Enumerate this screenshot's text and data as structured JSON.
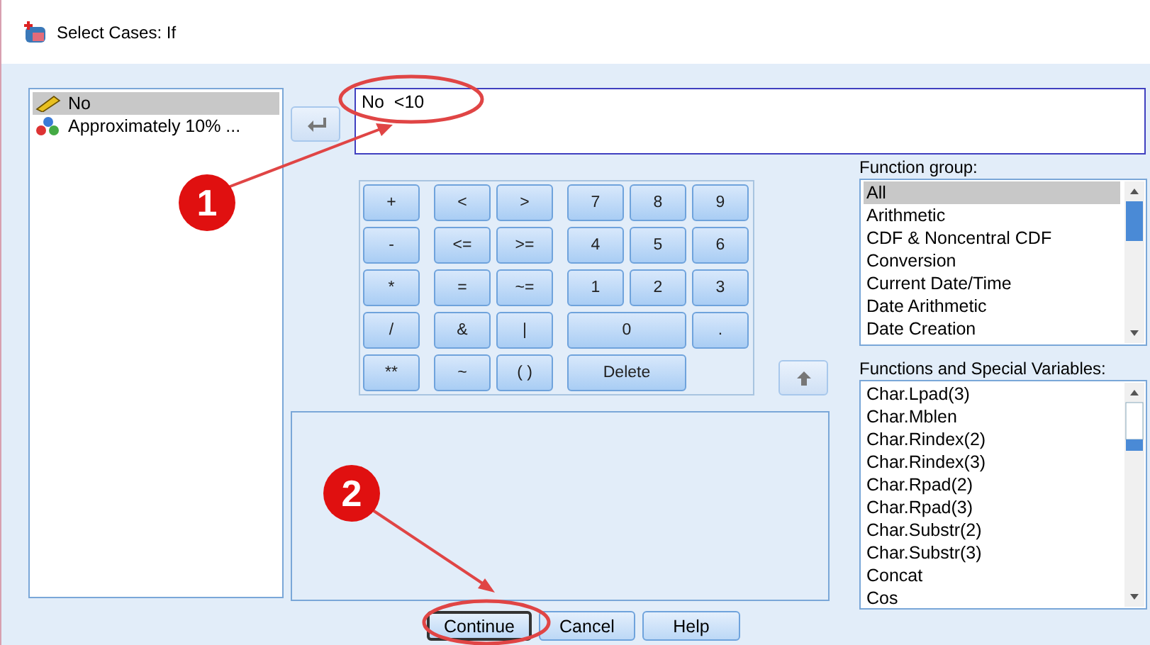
{
  "window": {
    "title": "Select Cases: If"
  },
  "variables": [
    {
      "name": "No",
      "kind": "scale",
      "selected": true
    },
    {
      "name": "Approximately 10% ...",
      "kind": "nominal",
      "selected": false
    }
  ],
  "expression": {
    "value": "No  <10"
  },
  "keypad": [
    {
      "ops": [
        "+"
      ],
      "compare": [
        "<",
        ">"
      ],
      "digits": [
        {
          "label": "7",
          "kind": "normal"
        },
        {
          "label": "8",
          "kind": "normal"
        },
        {
          "label": "9",
          "kind": "normal"
        }
      ]
    },
    {
      "ops": [
        "-"
      ],
      "compare": [
        "<=",
        ">="
      ],
      "digits": [
        {
          "label": "4",
          "kind": "normal"
        },
        {
          "label": "5",
          "kind": "normal"
        },
        {
          "label": "6",
          "kind": "normal"
        }
      ]
    },
    {
      "ops": [
        "*"
      ],
      "compare": [
        "=",
        "~="
      ],
      "digits": [
        {
          "label": "1",
          "kind": "normal"
        },
        {
          "label": "2",
          "kind": "normal"
        },
        {
          "label": "3",
          "kind": "normal"
        }
      ]
    },
    {
      "ops": [
        "/"
      ],
      "compare": [
        "&",
        "|"
      ],
      "digits": [
        {
          "label": "0",
          "kind": "wide"
        },
        {
          "label": ".",
          "kind": "normal"
        }
      ]
    },
    {
      "ops": [
        "**"
      ],
      "compare": [
        "~",
        "( )"
      ],
      "digits": [
        {
          "label": "Delete",
          "kind": "wide"
        }
      ]
    }
  ],
  "function_group": {
    "label": "Function group:",
    "items": [
      {
        "label": "All",
        "selected": true
      },
      {
        "label": "Arithmetic",
        "selected": false
      },
      {
        "label": "CDF & Noncentral CDF",
        "selected": false
      },
      {
        "label": "Conversion",
        "selected": false
      },
      {
        "label": "Current Date/Time",
        "selected": false
      },
      {
        "label": "Date Arithmetic",
        "selected": false
      },
      {
        "label": "Date Creation",
        "selected": false
      }
    ]
  },
  "functions": {
    "label": "Functions and Special Variables:",
    "items": [
      {
        "label": "Char.Lpad(3)",
        "selected": false
      },
      {
        "label": "Char.Mblen",
        "selected": false
      },
      {
        "label": "Char.Rindex(2)",
        "selected": false
      },
      {
        "label": "Char.Rindex(3)",
        "selected": false
      },
      {
        "label": "Char.Rpad(2)",
        "selected": false
      },
      {
        "label": "Char.Rpad(3)",
        "selected": false
      },
      {
        "label": "Char.Substr(2)",
        "selected": false
      },
      {
        "label": "Char.Substr(3)",
        "selected": false
      },
      {
        "label": "Concat",
        "selected": false
      },
      {
        "label": "Cos",
        "selected": false
      }
    ]
  },
  "buttons": [
    {
      "label": "Continue",
      "kind": "default"
    },
    {
      "label": "Cancel",
      "kind": "normal"
    },
    {
      "label": "Help",
      "kind": "normal"
    }
  ],
  "annotations": [
    {
      "number": "1"
    },
    {
      "number": "2"
    }
  ]
}
